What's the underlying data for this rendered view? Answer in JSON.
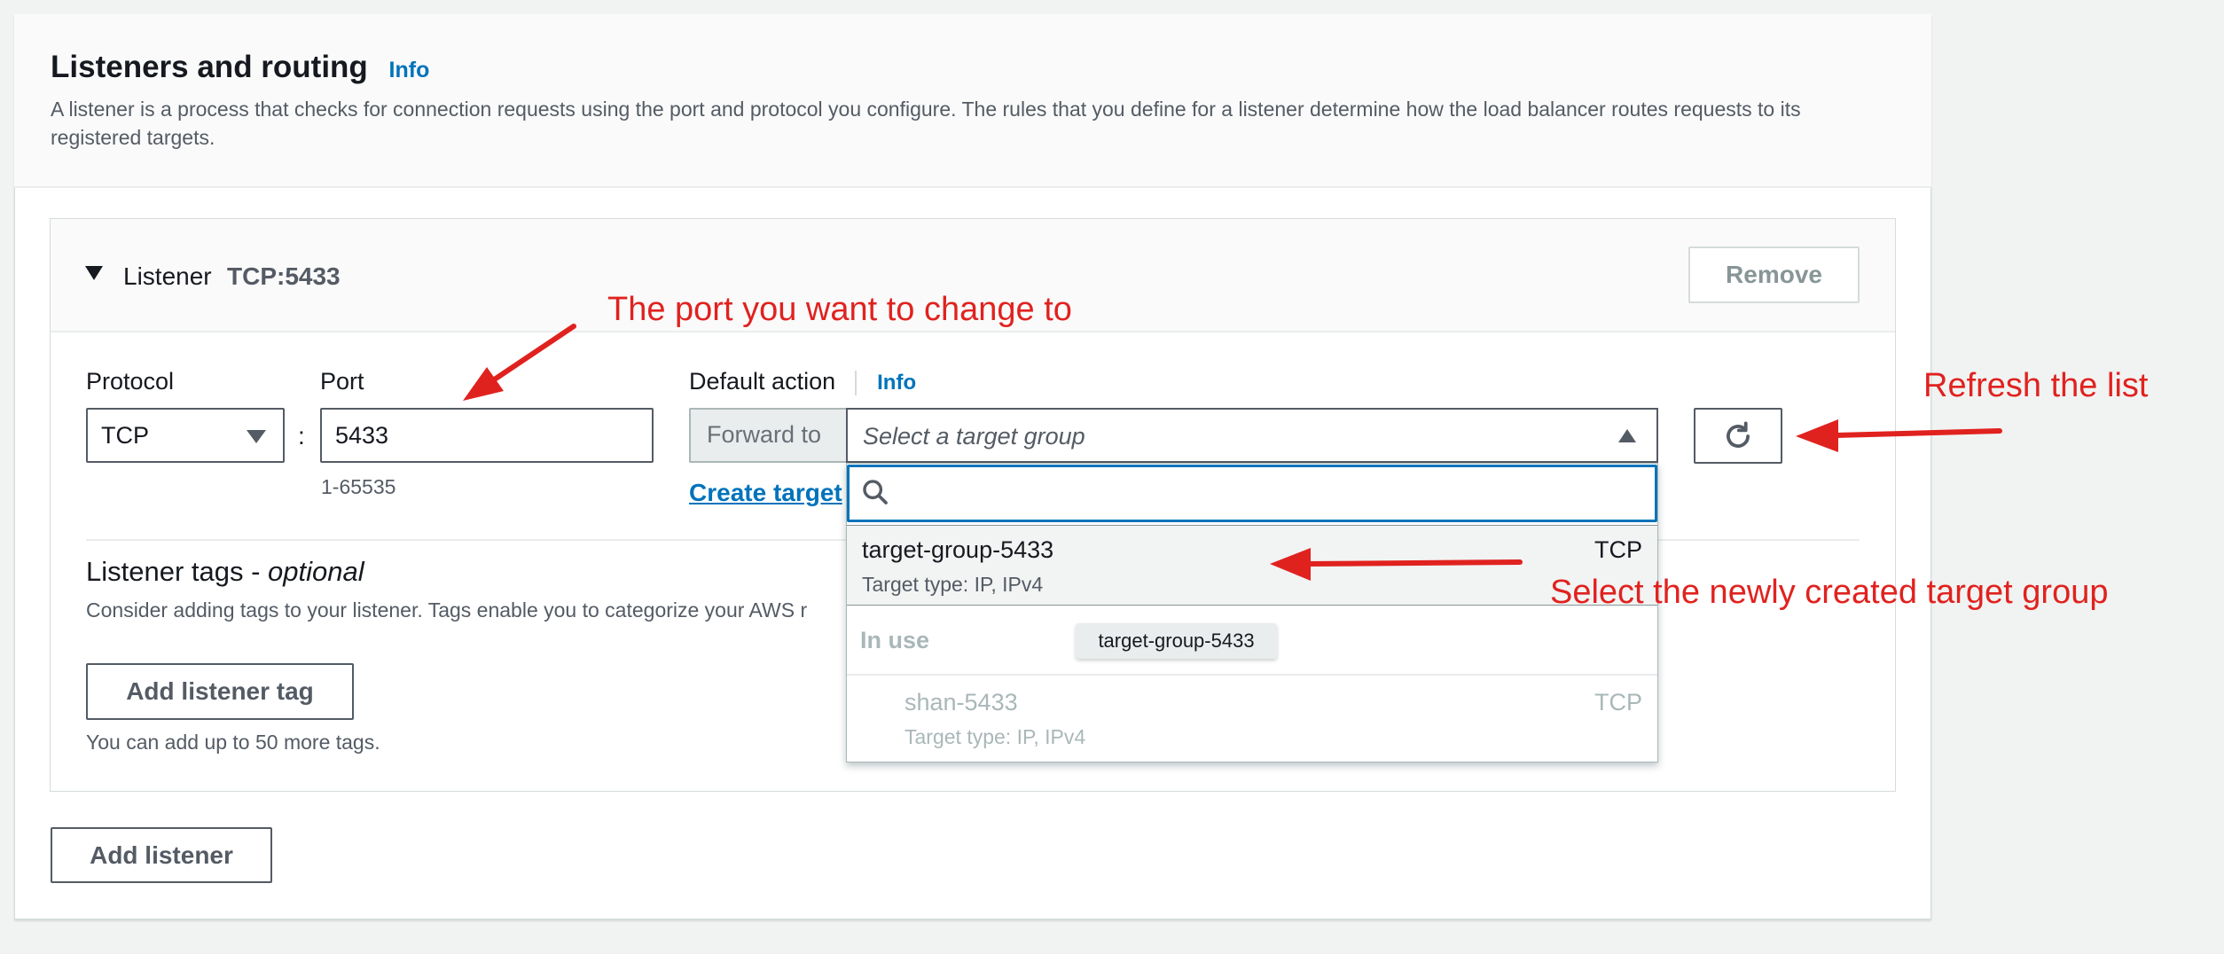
{
  "panel": {
    "title": "Listeners and routing",
    "info_label": "Info",
    "description": "A listener is a process that checks for connection requests using the port and protocol you configure. The rules that you define for a listener determine how the load balancer routes requests to its registered targets."
  },
  "listener": {
    "label": "Listener",
    "value": "TCP:5433",
    "remove_label": "Remove",
    "protocol_label": "Protocol",
    "protocol_value": "TCP",
    "port_label": "Port",
    "port_value": "5433",
    "port_hint": "1-65535",
    "default_action_label": "Default action",
    "default_action_info": "Info",
    "forward_label": "Forward to",
    "target_placeholder": "Select a target group",
    "create_target_label": "Create target"
  },
  "tags": {
    "title_prefix": "Listener tags - ",
    "title_optional": "optional",
    "description": "Consider adding tags to your listener. Tags enable you to categorize your AWS r",
    "add_tag_label": "Add listener tag",
    "hint": "You can add up to 50 more tags."
  },
  "add_listener_label": "Add listener",
  "dropdown": {
    "search_value": "",
    "options": [
      {
        "name": "target-group-5433",
        "subtitle": "Target type: IP, IPv4",
        "protocol": "TCP"
      }
    ],
    "group_label": "In use",
    "tooltip": "target-group-5433",
    "in_use_options": [
      {
        "name": "shan-5433",
        "subtitle": "Target type: IP, IPv4",
        "protocol": "TCP"
      }
    ]
  },
  "annotations": {
    "port": "The port you want to change to",
    "refresh": "Refresh the list",
    "select": "Select the newly created target group"
  },
  "colors": {
    "accent": "#0073bb",
    "annotation": "#e0221f",
    "text": "#16191f",
    "secondary_text": "#545b64"
  },
  "icons": [
    "caret-down-icon",
    "triangle-down-icon",
    "triangle-up-icon",
    "refresh-icon",
    "search-icon"
  ]
}
